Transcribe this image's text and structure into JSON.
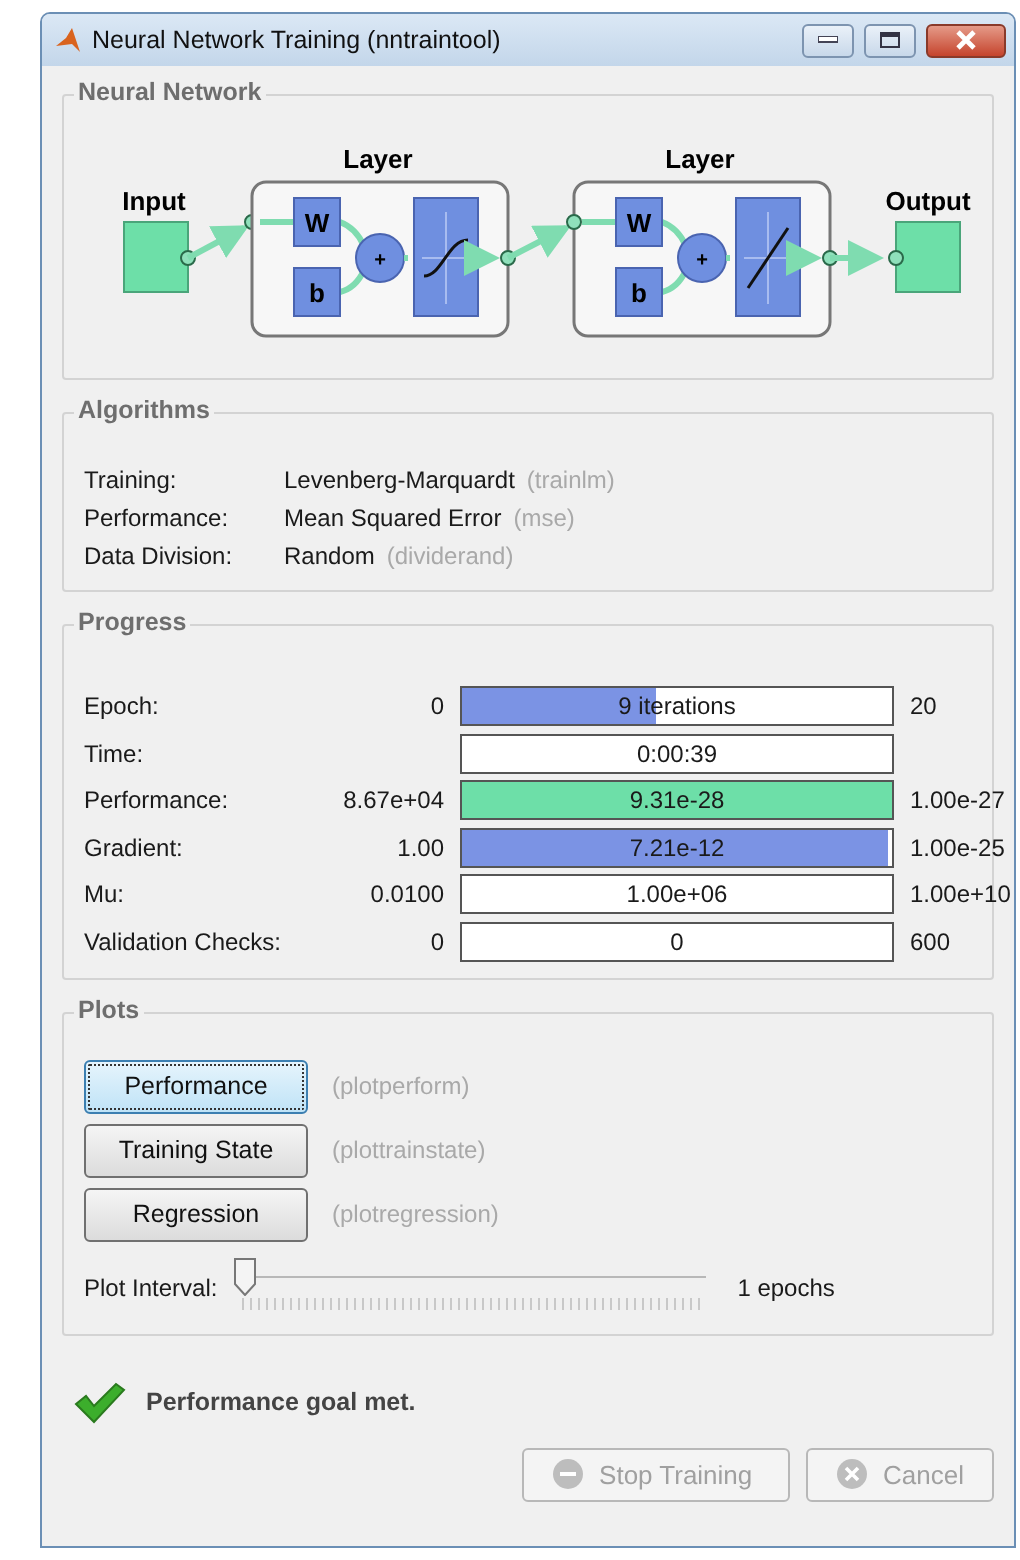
{
  "window": {
    "title": "Neural Network Training (nntraintool)"
  },
  "network": {
    "title": "Neural Network",
    "input_label": "Input",
    "output_label": "Output",
    "layers": [
      {
        "label": "Layer",
        "weight": "W",
        "bias": "b",
        "sum": "+",
        "kind": "sigmoid"
      },
      {
        "label": "Layer",
        "weight": "W",
        "bias": "b",
        "sum": "+",
        "kind": "linear"
      }
    ]
  },
  "algorithms": {
    "title": "Algorithms",
    "rows": [
      {
        "label": "Training:",
        "value": "Levenberg-Marquardt",
        "function": "(trainlm)"
      },
      {
        "label": "Performance:",
        "value": "Mean Squared Error",
        "function": "(mse)"
      },
      {
        "label": "Data Division:",
        "value": "Random",
        "function": "(dividerand)"
      }
    ]
  },
  "progress": {
    "title": "Progress",
    "rows": [
      {
        "label": "Epoch:",
        "min": "0",
        "text": "9 iterations",
        "max": "20",
        "level": 0.45,
        "color": "#7b93e4"
      },
      {
        "label": "Time:",
        "text": "0:00:39"
      },
      {
        "label": "Performance:",
        "min": "8.67e+04",
        "text": "9.31e-28",
        "max": "1.00e-27",
        "level": 1,
        "color": "#6ddfa8"
      },
      {
        "label": "Gradient:",
        "min": "1.00",
        "text": "7.21e-12",
        "max": "1.00e-25",
        "level": 0.99,
        "color": "#7b93e4"
      },
      {
        "label": "Mu:",
        "min": "0.0100",
        "text": "1.00e+06",
        "max": "1.00e+10"
      },
      {
        "label": "Validation Checks:",
        "min": "0",
        "text": "0",
        "max": "600"
      }
    ]
  },
  "plots": {
    "title": "Plots",
    "buttons": [
      {
        "label": "Performance",
        "function": "(plotperform)",
        "focused": true
      },
      {
        "label": "Training State",
        "function": "(plottrainstate)",
        "focused": false
      },
      {
        "label": "Regression",
        "function": "(plotregression)",
        "focused": false
      }
    ],
    "slider": {
      "label": "Plot Interval:",
      "level": 0,
      "reading": "1 epochs"
    }
  },
  "status": {
    "text": "Performance goal met."
  },
  "buttons": [
    {
      "label": "Stop Training",
      "kind": "stop",
      "disabled": true
    },
    {
      "label": "Cancel",
      "kind": "cancel",
      "disabled": true
    }
  ]
}
